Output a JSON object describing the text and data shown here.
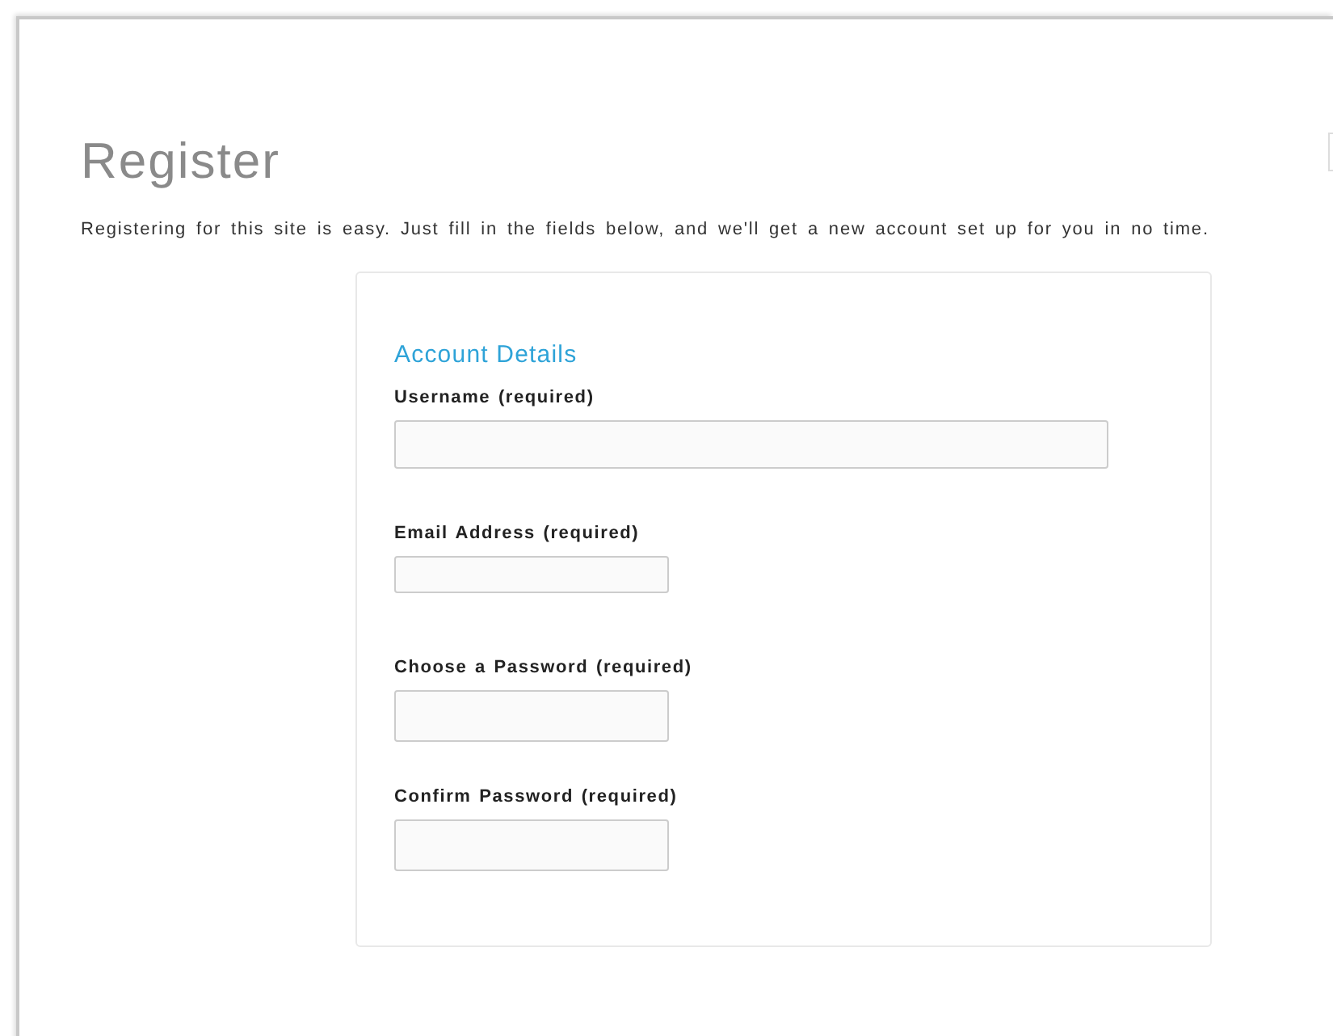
{
  "page": {
    "title": "Register",
    "intro": "Registering for this site is easy. Just fill in the fields below, and we'll get a new account set up for you in no time."
  },
  "form": {
    "heading": "Account Details",
    "fields": [
      {
        "label": "Username (required)"
      },
      {
        "label": "Email Address (required)"
      },
      {
        "label": "Choose a Password (required)"
      },
      {
        "label": "Confirm Password (required)"
      }
    ]
  }
}
